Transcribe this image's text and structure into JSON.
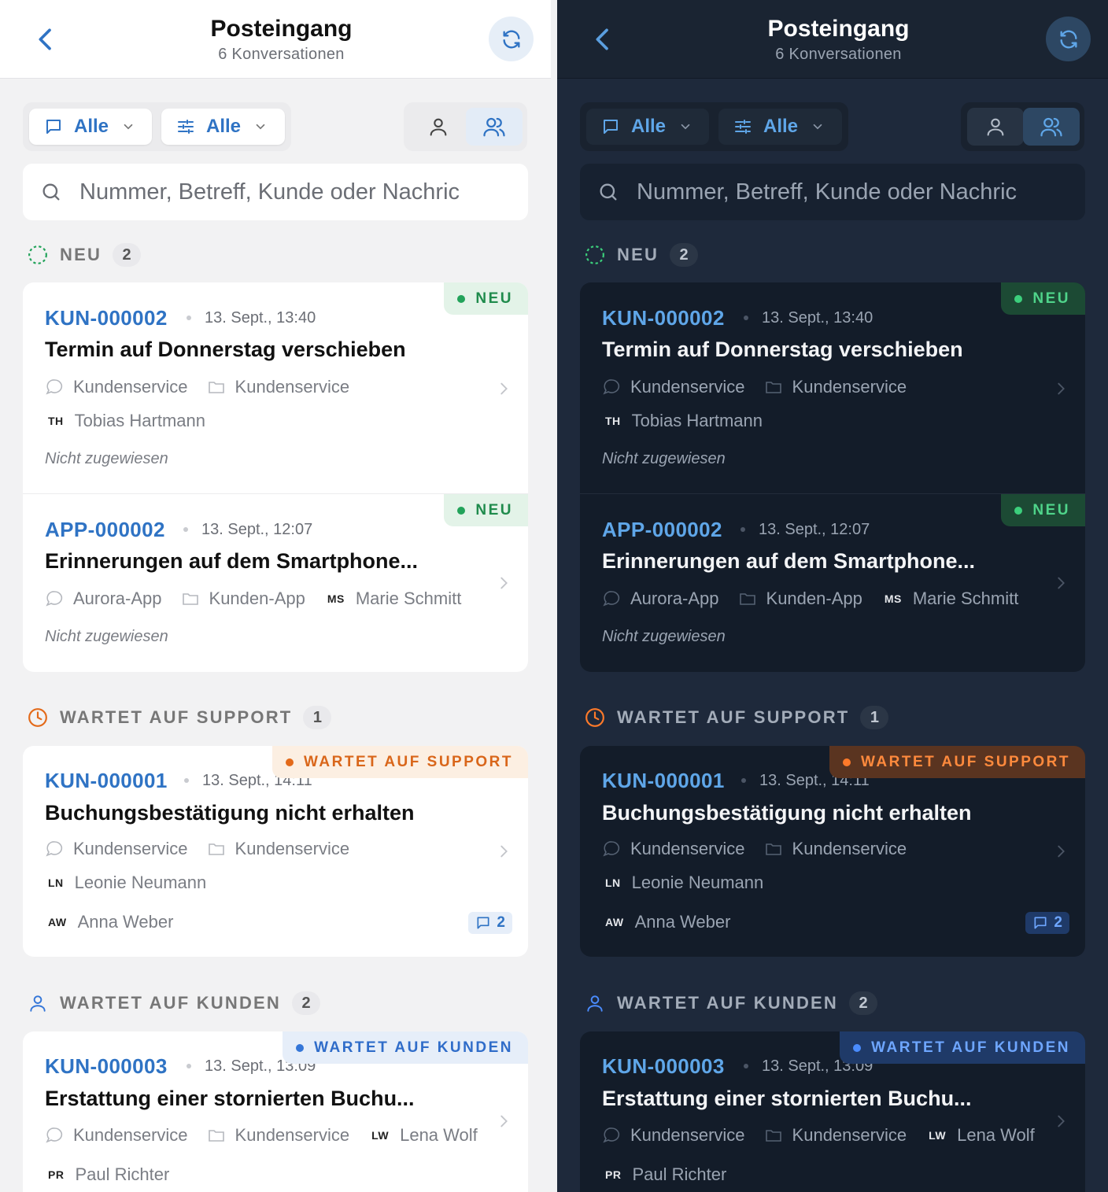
{
  "header": {
    "title": "Posteingang",
    "subtitle": "6 Konversationen"
  },
  "filters": {
    "channel_label": "Alle",
    "options_label": "Alle"
  },
  "search": {
    "placeholder": "Nummer, Betreff, Kunde oder Nachric"
  },
  "sections": [
    {
      "title": "NEU",
      "count": "2",
      "tickets": [
        {
          "id": "KUN-000002",
          "time": "13. Sept., 13:40",
          "subject": "Termin auf Donnerstag verschieben",
          "status": "NEU",
          "channel": "Kundenservice",
          "folder": "Kundenservice",
          "customer_initials": "TH",
          "customer": "Tobias Hartmann",
          "assignee": "Nicht zugewiesen"
        },
        {
          "id": "APP-000002",
          "time": "13. Sept., 12:07",
          "subject": "Erinnerungen auf dem Smartphone...",
          "status": "NEU",
          "channel": "Aurora-App",
          "folder": "Kunden-App",
          "customer_initials": "MS",
          "customer": "Marie Schmitt",
          "assignee": "Nicht zugewiesen"
        }
      ]
    },
    {
      "title": "WARTET AUF SUPPORT",
      "count": "1",
      "tickets": [
        {
          "id": "KUN-000001",
          "time": "13. Sept., 14:11",
          "subject": "Buchungsbestätigung nicht erhalten",
          "status": "WARTET AUF SUPPORT",
          "channel": "Kundenservice",
          "folder": "Kundenservice",
          "customer_initials": "LN",
          "customer": "Leonie Neumann",
          "assignee_initials": "AW",
          "assignee": "Anna Weber",
          "messages": "2"
        }
      ]
    },
    {
      "title": "WARTET AUF KUNDEN",
      "count": "2",
      "tickets": [
        {
          "id": "KUN-000003",
          "time": "13. Sept., 13:09",
          "subject": "Erstattung einer stornierten Buchu...",
          "status": "WARTET AUF KUNDEN",
          "channel": "Kundenservice",
          "folder": "Kundenservice",
          "customer_initials": "LW",
          "customer": "Lena Wolf",
          "assignee_initials": "PR",
          "assignee": "Paul Richter"
        }
      ]
    }
  ],
  "icons": [
    "back-icon",
    "refresh-icon",
    "chat-icon",
    "filter-sliders-icon",
    "chevron-down-icon",
    "user-icon",
    "users-icon",
    "search-icon",
    "status-dashed-circle-icon",
    "clock-icon",
    "chevron-right-icon",
    "folder-icon",
    "message-icon"
  ],
  "colors": {
    "accent_light": "#2f73c4",
    "accent_dark": "#5fa6e8",
    "neu_green": "#22a35a",
    "support_orange": "#e36a1a",
    "kunden_blue": "#3476d8",
    "dark_bg": "#1e293b"
  }
}
